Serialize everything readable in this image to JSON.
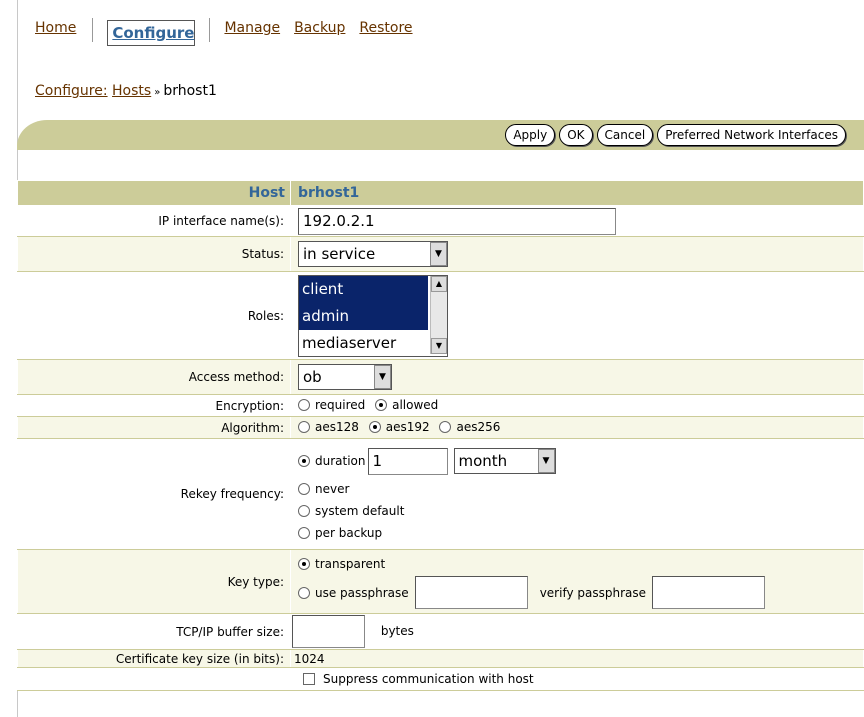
{
  "tabs": [
    "Home",
    "Configure",
    "Manage",
    "Backup",
    "Restore"
  ],
  "breadcrumb": {
    "part1": "Configure:",
    "part2": "Hosts",
    "current": "brhost1"
  },
  "buttons": {
    "apply": "Apply",
    "ok": "OK",
    "cancel": "Cancel",
    "preferred": "Preferred Network Interfaces"
  },
  "header": {
    "label": "Host",
    "value": "brhost1"
  },
  "fields": {
    "ip": {
      "label": "IP interface name(s):",
      "value": "192.0.2.1"
    },
    "status": {
      "label": "Status:",
      "value": "in service"
    },
    "roles": {
      "label": "Roles:",
      "items": [
        "client",
        "admin",
        "mediaserver"
      ]
    },
    "access": {
      "label": "Access method:",
      "value": "ob"
    },
    "encryption": {
      "label": "Encryption:",
      "options": [
        "required",
        "allowed"
      ],
      "selected": "allowed"
    },
    "algorithm": {
      "label": "Algorithm:",
      "options": [
        "aes128",
        "aes192",
        "aes256"
      ],
      "selected": "aes192"
    },
    "rekey": {
      "label": "Rekey frequency:",
      "duration_label": "duration",
      "duration_value": "1",
      "unit": "month",
      "never": "never",
      "system_default": "system default",
      "per_backup": "per backup"
    },
    "keytype": {
      "label": "Key type:",
      "transparent": "transparent",
      "use_passphrase": "use passphrase",
      "verify": "verify passphrase"
    },
    "tcp": {
      "label": "TCP/IP buffer size:",
      "unit": "bytes"
    },
    "cert": {
      "label": "Certificate key size (in bits):",
      "value": "1024"
    },
    "suppress": {
      "label": "Suppress communication with host"
    }
  }
}
